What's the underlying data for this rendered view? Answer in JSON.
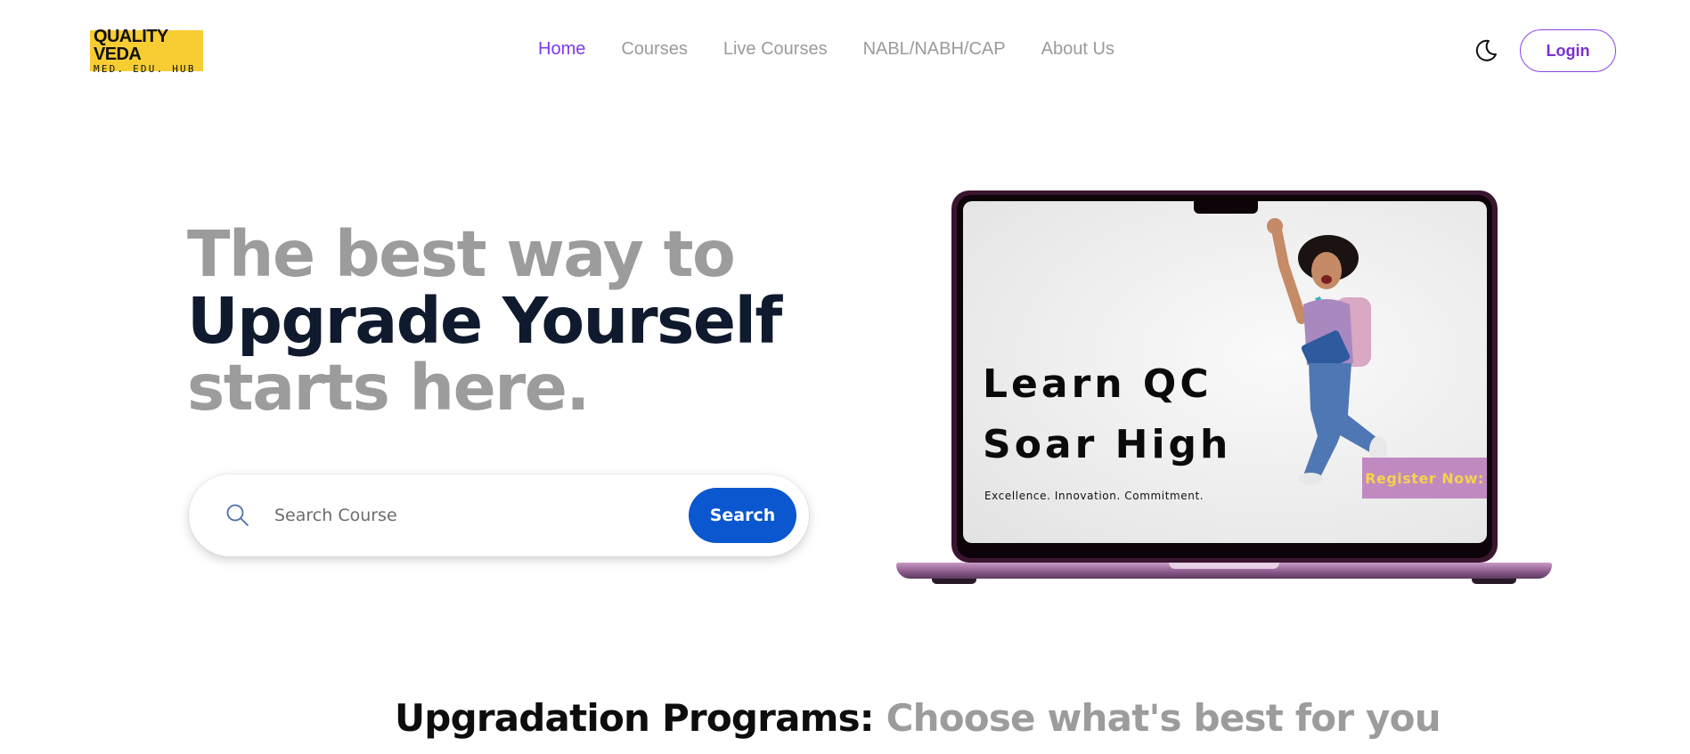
{
  "header": {
    "logo": {
      "line1": "QUALITY VEDA",
      "line2": "MED. EDU. HUB"
    },
    "nav": [
      {
        "label": "Home",
        "active": true
      },
      {
        "label": "Courses",
        "active": false
      },
      {
        "label": "Live Courses",
        "active": false
      },
      {
        "label": "NABL/NABH/CAP",
        "active": false
      },
      {
        "label": "About Us",
        "active": false
      }
    ],
    "theme_toggle_icon": "moon-icon",
    "login_label": "Login"
  },
  "hero": {
    "line1": "The best way to",
    "line2": "Upgrade Yourself",
    "line3": "starts here."
  },
  "search": {
    "icon": "search-icon",
    "placeholder": "Search Course",
    "button_label": "Search"
  },
  "banner": {
    "headline1": "Learn QC",
    "headline2": "Soar High",
    "tagline": "Excellence. Innovation. Commitment.",
    "register_label": "Register Now:"
  },
  "programs": {
    "title_dark": "Upgradation Programs:",
    "title_grey": "Choose what's best for you"
  },
  "colors": {
    "accent": "#7c3aed",
    "search_button": "#0b57d0",
    "logo_bg": "#f7cd33"
  }
}
